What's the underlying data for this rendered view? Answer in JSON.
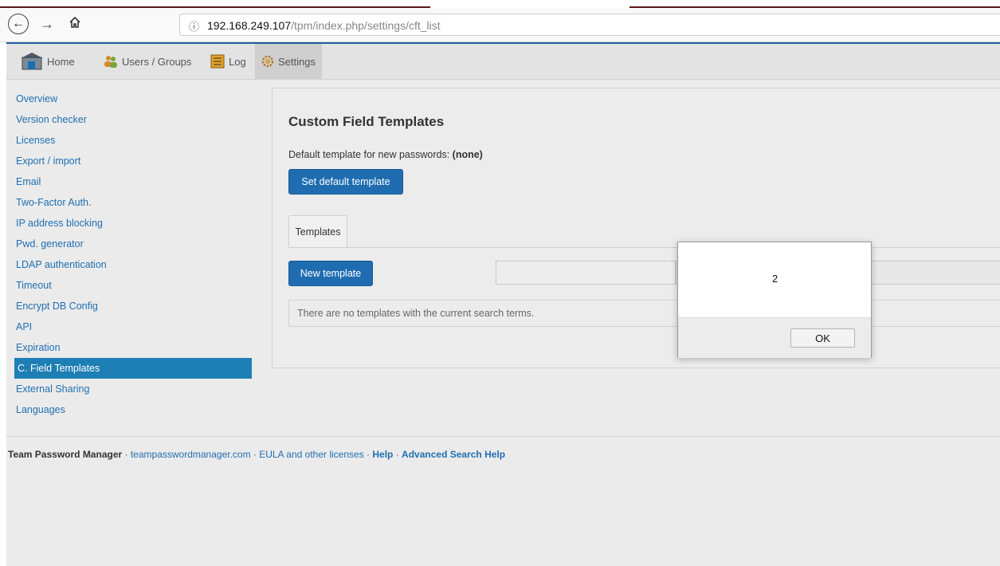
{
  "browser": {
    "url_host": "192.168.249.107",
    "url_path": "/tpm/index.php/settings/cft_list"
  },
  "topnav": {
    "items": [
      {
        "label": "Home",
        "icon": "home-icon"
      },
      {
        "label": "Users / Groups",
        "icon": "users-icon"
      },
      {
        "label": "Log",
        "icon": "log-icon"
      },
      {
        "label": "Settings",
        "icon": "gear-icon"
      }
    ]
  },
  "sidebar": {
    "items": [
      {
        "label": "Overview"
      },
      {
        "label": "Version checker"
      },
      {
        "label": "Licenses"
      },
      {
        "label": "Export / import"
      },
      {
        "label": "Email"
      },
      {
        "label": "Two-Factor Auth."
      },
      {
        "label": "IP address blocking"
      },
      {
        "label": "Pwd. generator"
      },
      {
        "label": "LDAP authentication"
      },
      {
        "label": "Timeout"
      },
      {
        "label": "Encrypt DB Config"
      },
      {
        "label": "API"
      },
      {
        "label": "Expiration"
      },
      {
        "label": "C. Field Templates",
        "active": true
      },
      {
        "label": "External Sharing"
      },
      {
        "label": "Languages"
      }
    ]
  },
  "main": {
    "title": "Custom Field Templates",
    "default_label": "Default template for new passwords: ",
    "default_value": "(none)",
    "set_default_button": "Set default template",
    "tab_templates": "Templates",
    "new_template_button": "New template",
    "empty_message": "There are no templates with the current search terms."
  },
  "footer": {
    "product": "Team Password Manager",
    "sep": " · ",
    "site": "teampasswordmanager.com",
    "eula": "EULA and other licenses",
    "help": "Help",
    "adv_help": "Advanced Search Help"
  },
  "dialog": {
    "message": "2",
    "ok_label": "OK"
  },
  "colors": {
    "accent": "#1f6db0",
    "active_sidebar": "#1d7fb3",
    "nav_border": "#1f5e9c"
  }
}
